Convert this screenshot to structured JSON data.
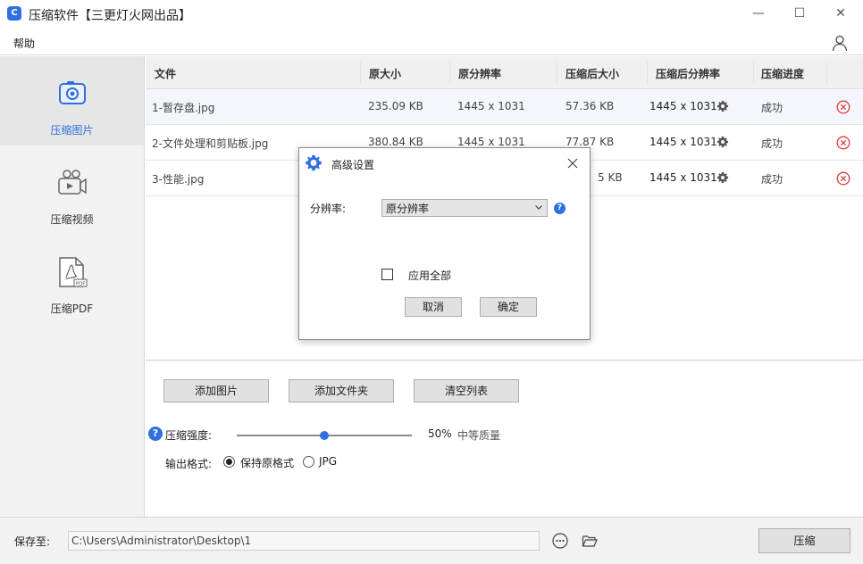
{
  "window": {
    "title": "压缩软件【三更灯火网出品】",
    "app_icon_letter": "C",
    "minimize": "—",
    "maximize": "☐",
    "close": "✕"
  },
  "menu": {
    "help": "帮助",
    "user_icon": "user-icon"
  },
  "sidebar": {
    "items": [
      {
        "label": "压缩图片",
        "icon": "image-icon",
        "active": true
      },
      {
        "label": "压缩视频",
        "icon": "video-icon",
        "active": false
      },
      {
        "label": "压缩PDF",
        "icon": "pdf-icon",
        "active": false
      }
    ],
    "pdf_badge": "PDF"
  },
  "table": {
    "headers": [
      "文件",
      "原大小",
      "原分辨率",
      "压缩后大小",
      "压缩后分辨率",
      "压缩进度"
    ],
    "rows": [
      {
        "file": "1-暂存盘.jpg",
        "orig_size": "235.09 KB",
        "orig_res": "1445 x 1031",
        "new_size": "57.36 KB",
        "new_res": "1445 x 1031",
        "status": "成功"
      },
      {
        "file": "2-文件处理和剪贴板.jpg",
        "orig_size": "380.84 KB",
        "orig_res": "1445 x 1031",
        "new_size": "77.87 KB",
        "new_res": "1445 x 1031",
        "status": "成功"
      },
      {
        "file": "3-性能.jpg",
        "orig_size": "",
        "orig_res": "",
        "new_size": "5 KB",
        "new_res": "1445 x 1031",
        "status": "成功"
      }
    ]
  },
  "actions": {
    "add_image": "添加图片",
    "add_folder": "添加文件夹",
    "clear_list": "清空列表"
  },
  "compression": {
    "help_mark": "?",
    "strength_label": "压缩强度:",
    "strength_value": 0.5,
    "strength_percent": "50%",
    "quality_label": "中等质量",
    "format_label": "输出格式:",
    "format_options": [
      "保持原格式",
      "JPG"
    ],
    "format_selected": "保持原格式"
  },
  "footer": {
    "save_label": "保存至:",
    "save_path": "C:\\Users\\Administrator\\Desktop\\1",
    "compress_button": "压缩"
  },
  "dialog": {
    "title": "高级设置",
    "resolution_label": "分辨率:",
    "resolution_value": "原分辨率",
    "help_mark": "?",
    "apply_all_label": "应用全部",
    "apply_all_checked": false,
    "cancel": "取消",
    "ok": "确定"
  },
  "colors": {
    "accent": "#2f6fe0",
    "error_red": "#e03c3c"
  }
}
